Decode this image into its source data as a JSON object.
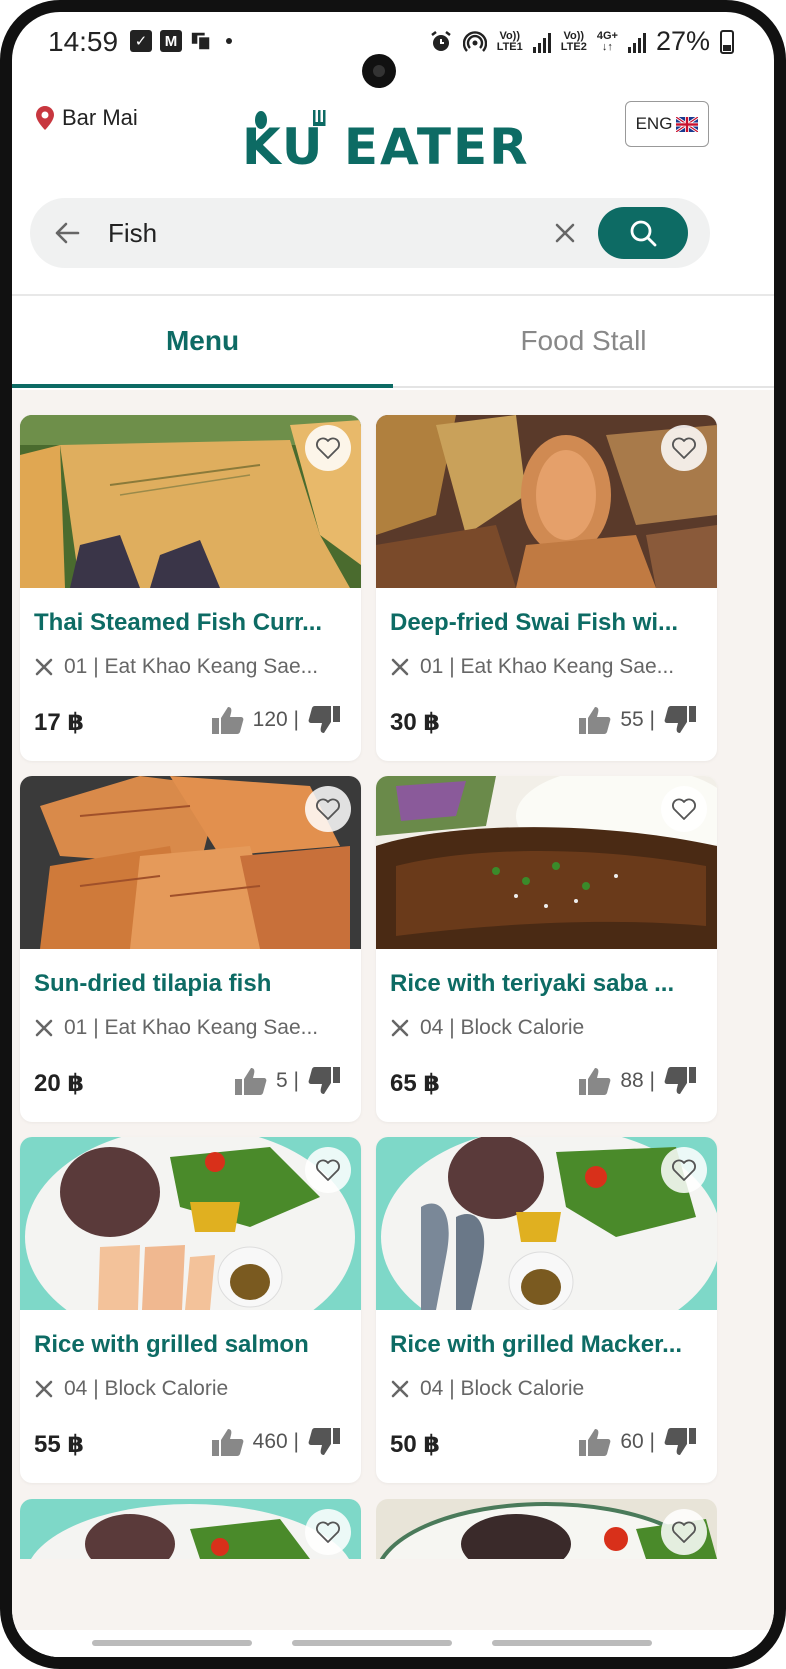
{
  "status_bar": {
    "time": "14:59",
    "left_icons": [
      "check-box-icon",
      "gmail-icon",
      "cast-icon"
    ],
    "lte1_top": "Vo))",
    "lte1_bottom": "LTE1",
    "lte2_top": "Vo))",
    "lte2_bottom": "LTE2",
    "net_top": "4G+",
    "net_bottom": "↓↑",
    "battery": "27%"
  },
  "header": {
    "location": "Bar Mai",
    "logo_text": "KU EATER",
    "language": "ENG"
  },
  "search": {
    "value": "Fish",
    "placeholder": ""
  },
  "tabs": [
    {
      "label": "Menu",
      "active": true
    },
    {
      "label": "Food Stall",
      "active": false
    }
  ],
  "menu_items": [
    {
      "title": "Thai Steamed Fish Curr...",
      "stall": "01 | Eat Khao Keang Sae...",
      "price": "17 ฿",
      "likes": "120 |"
    },
    {
      "title": "Deep-fried Swai Fish wi...",
      "stall": "01 | Eat Khao Keang Sae...",
      "price": "30 ฿",
      "likes": "55 |"
    },
    {
      "title": "Sun-dried tilapia fish",
      "stall": "01 | Eat Khao Keang Sae...",
      "price": "20 ฿",
      "likes": "5 |"
    },
    {
      "title": "Rice with teriyaki saba ...",
      "stall": "04 | Block Calorie",
      "price": "65 ฿",
      "likes": "88 |"
    },
    {
      "title": "Rice with grilled salmon",
      "stall": "04 | Block Calorie",
      "price": "55 ฿",
      "likes": "460 |"
    },
    {
      "title": "Rice with grilled Macker...",
      "stall": "04 | Block Calorie",
      "price": "50 ฿",
      "likes": "60 |"
    }
  ],
  "colors": {
    "brand": "#0d6b64",
    "background": "#f7f3f0",
    "pin": "#c8373f"
  }
}
